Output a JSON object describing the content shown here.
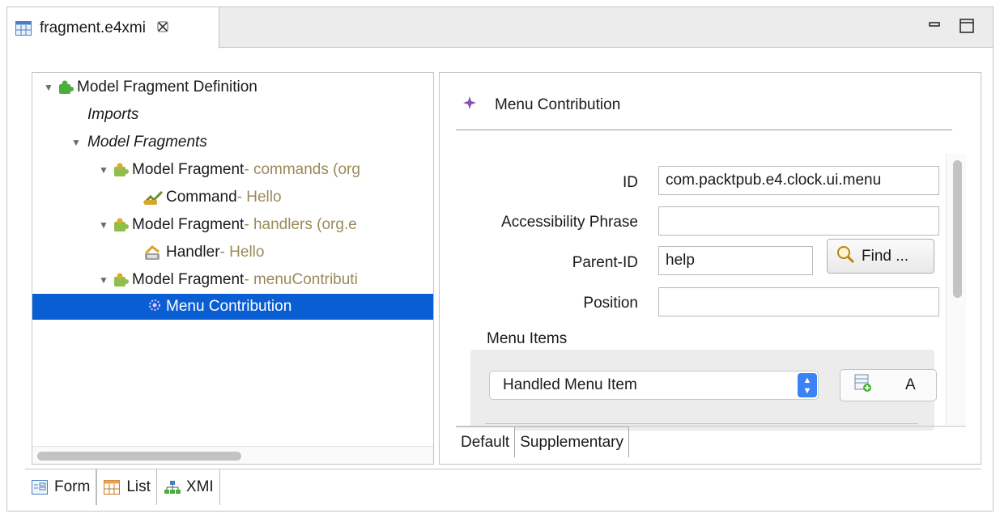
{
  "editor_tab": {
    "title": "fragment.e4xmi",
    "close_icon": "close-icon",
    "file_icon": "table-file-icon"
  },
  "window_controls": {
    "minimize": "minimize-icon",
    "maximize": "maximize-icon"
  },
  "tree": {
    "items": [
      {
        "label": "Model Fragment Definition",
        "suffix": "",
        "expanded": true,
        "italic": false,
        "icon": "puzzle-green-icon"
      },
      {
        "label": "Imports",
        "suffix": "",
        "expanded": false,
        "italic": true,
        "icon": ""
      },
      {
        "label": "Model Fragments",
        "suffix": "",
        "expanded": true,
        "italic": true,
        "icon": ""
      },
      {
        "label": "Model Fragment",
        "suffix": " - commands (org",
        "expanded": true,
        "italic": false,
        "icon": "puzzle-partial-icon"
      },
      {
        "label": "Command",
        "suffix": " - Hello",
        "expanded": false,
        "italic": false,
        "icon": "command-icon"
      },
      {
        "label": "Model Fragment",
        "suffix": " - handlers (org.e",
        "expanded": true,
        "italic": false,
        "icon": "puzzle-partial-icon"
      },
      {
        "label": "Handler",
        "suffix": " - Hello",
        "expanded": false,
        "italic": false,
        "icon": "handler-icon"
      },
      {
        "label": "Model Fragment",
        "suffix": " - menuContributi",
        "expanded": true,
        "italic": false,
        "icon": "puzzle-partial-icon"
      },
      {
        "label": "Menu Contribution",
        "suffix": "",
        "expanded": false,
        "italic": false,
        "icon": "menu-contribution-icon",
        "selected": true
      }
    ]
  },
  "detail": {
    "header_icon": "sparkle-icon",
    "title": "Menu Contribution",
    "fields": {
      "id_label": "ID",
      "id_value": "com.packtpub.e4.clock.ui.menu",
      "accessibility_label": "Accessibility Phrase",
      "accessibility_value": "",
      "parent_label": "Parent-ID",
      "parent_value": "help",
      "position_label": "Position",
      "position_value": ""
    },
    "find_button": "Find ...",
    "menu_items_label": "Menu Items",
    "menu_item_type": "Handled Menu Item",
    "add_button": "A",
    "subtabs": [
      "Default",
      "Supplementary"
    ]
  },
  "bottom_tabs": [
    "Form",
    "List",
    "XMI"
  ],
  "colors": {
    "selection": "#0a5ed3",
    "muted_text": "#9a8a5a",
    "accent_purple": "#8a4fb5"
  }
}
